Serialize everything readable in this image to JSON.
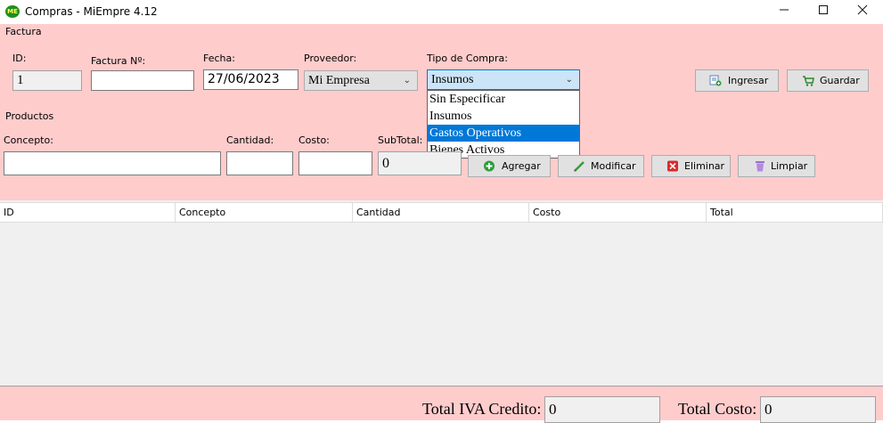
{
  "window": {
    "title": "Compras - MiEmpre 4.12",
    "icon_text": "ME"
  },
  "factura": {
    "section_label": "Factura",
    "id_label": "ID:",
    "id_value": "1",
    "numero_label": "Factura Nº:",
    "numero_value": "",
    "fecha_label": "Fecha:",
    "fecha_value": "27/06/2023",
    "proveedor_label": "Proveedor:",
    "proveedor_value": "Mi Empresa",
    "tipo_label": "Tipo de Compra:",
    "tipo_value": "Insumos",
    "tipo_options": [
      "Sin Especificar",
      "Insumos",
      "Gastos Operativos",
      "Bienes Activos"
    ],
    "tipo_highlighted": "Gastos Operativos",
    "ingresar_label": "Ingresar",
    "guardar_label": "Guardar"
  },
  "productos": {
    "section_label": "Productos",
    "concepto_label": "Concepto:",
    "concepto_value": "",
    "cantidad_label": "Cantidad:",
    "cantidad_value": "",
    "costo_label": "Costo:",
    "costo_value": "",
    "subtotal_label": "SubTotal:",
    "subtotal_value": "0",
    "agregar_label": "Agregar",
    "modificar_label": "Modificar",
    "eliminar_label": "Eliminar",
    "limpiar_label": "Limpiar"
  },
  "grid": {
    "columns": [
      "ID",
      "Concepto",
      "Cantidad",
      "Costo",
      "Total"
    ]
  },
  "totals": {
    "iva_label": "Total IVA Credito:",
    "iva_value": "0",
    "costo_label": "Total Costo:",
    "costo_value": "0"
  },
  "colors": {
    "form_bg": "#ffcccc",
    "selection": "#0078d7",
    "grid_bg": "#f0f0f0"
  },
  "icons": {
    "ingresar": "document-add-icon",
    "guardar": "cart-icon",
    "agregar": "plus-circle-icon",
    "modificar": "pencil-icon",
    "eliminar": "delete-x-icon",
    "limpiar": "trash-icon"
  }
}
